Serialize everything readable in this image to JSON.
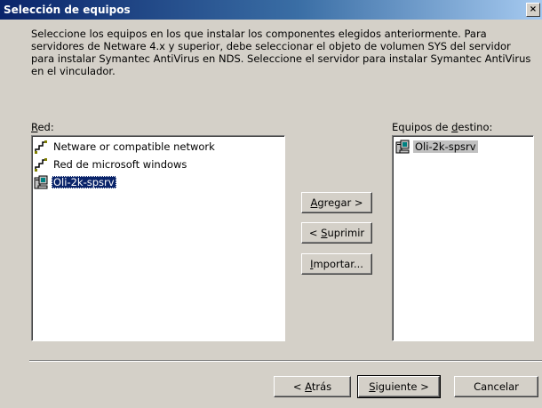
{
  "window": {
    "title": "Selección de equipos",
    "close_label": "×"
  },
  "description": "Seleccione los equipos en los que instalar los componentes elegidos anteriormente. Para servidores de Netware 4.x y superior, debe seleccionar el objeto de volumen SYS del servidor para instalar Symantec AntiVirus en NDS. Seleccione el servidor para instalar Symantec AntiVirus en el vinculador.",
  "network": {
    "label_first": "R",
    "label_rest": "ed:",
    "items": [
      {
        "label": "Netware or compatible network",
        "icon": "network-icon"
      },
      {
        "label": "Red de microsoft windows",
        "icon": "network-icon"
      },
      {
        "label": "Oli-2k-spsrv",
        "icon": "computer-icon",
        "selected": true
      }
    ]
  },
  "destination": {
    "label_pre": "Equipos de ",
    "label_u": "d",
    "label_post": "estino:",
    "items": [
      {
        "label": "Oli-2k-spsrv",
        "icon": "computer-icon"
      }
    ]
  },
  "buttons": {
    "add": {
      "u": "A",
      "rest": "gregar >"
    },
    "remove": {
      "pre": "< ",
      "u": "S",
      "rest": "uprimir"
    },
    "import": {
      "u": "I",
      "rest": "mportar..."
    },
    "back": {
      "pre": "< ",
      "u": "A",
      "rest": "trás"
    },
    "next": {
      "u": "S",
      "rest": "iguiente >"
    },
    "cancel": "Cancelar"
  }
}
